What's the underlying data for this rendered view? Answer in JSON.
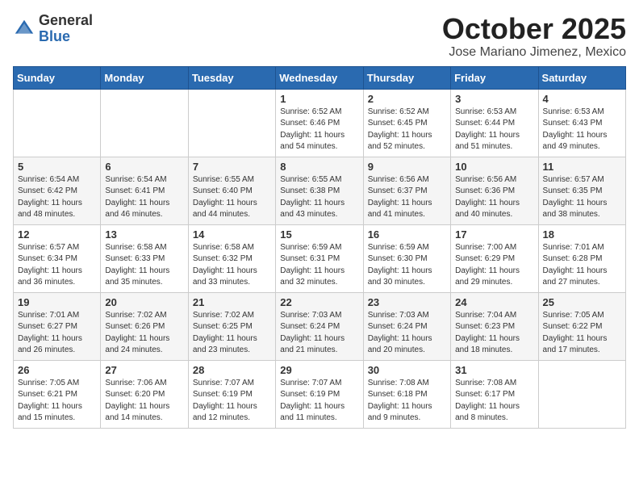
{
  "header": {
    "logo_general": "General",
    "logo_blue": "Blue",
    "month_title": "October 2025",
    "subtitle": "Jose Mariano Jimenez, Mexico"
  },
  "days_of_week": [
    "Sunday",
    "Monday",
    "Tuesday",
    "Wednesday",
    "Thursday",
    "Friday",
    "Saturday"
  ],
  "weeks": [
    [
      {
        "day": "",
        "info": ""
      },
      {
        "day": "",
        "info": ""
      },
      {
        "day": "",
        "info": ""
      },
      {
        "day": "1",
        "info": "Sunrise: 6:52 AM\nSunset: 6:46 PM\nDaylight: 11 hours\nand 54 minutes."
      },
      {
        "day": "2",
        "info": "Sunrise: 6:52 AM\nSunset: 6:45 PM\nDaylight: 11 hours\nand 52 minutes."
      },
      {
        "day": "3",
        "info": "Sunrise: 6:53 AM\nSunset: 6:44 PM\nDaylight: 11 hours\nand 51 minutes."
      },
      {
        "day": "4",
        "info": "Sunrise: 6:53 AM\nSunset: 6:43 PM\nDaylight: 11 hours\nand 49 minutes."
      }
    ],
    [
      {
        "day": "5",
        "info": "Sunrise: 6:54 AM\nSunset: 6:42 PM\nDaylight: 11 hours\nand 48 minutes."
      },
      {
        "day": "6",
        "info": "Sunrise: 6:54 AM\nSunset: 6:41 PM\nDaylight: 11 hours\nand 46 minutes."
      },
      {
        "day": "7",
        "info": "Sunrise: 6:55 AM\nSunset: 6:40 PM\nDaylight: 11 hours\nand 44 minutes."
      },
      {
        "day": "8",
        "info": "Sunrise: 6:55 AM\nSunset: 6:38 PM\nDaylight: 11 hours\nand 43 minutes."
      },
      {
        "day": "9",
        "info": "Sunrise: 6:56 AM\nSunset: 6:37 PM\nDaylight: 11 hours\nand 41 minutes."
      },
      {
        "day": "10",
        "info": "Sunrise: 6:56 AM\nSunset: 6:36 PM\nDaylight: 11 hours\nand 40 minutes."
      },
      {
        "day": "11",
        "info": "Sunrise: 6:57 AM\nSunset: 6:35 PM\nDaylight: 11 hours\nand 38 minutes."
      }
    ],
    [
      {
        "day": "12",
        "info": "Sunrise: 6:57 AM\nSunset: 6:34 PM\nDaylight: 11 hours\nand 36 minutes."
      },
      {
        "day": "13",
        "info": "Sunrise: 6:58 AM\nSunset: 6:33 PM\nDaylight: 11 hours\nand 35 minutes."
      },
      {
        "day": "14",
        "info": "Sunrise: 6:58 AM\nSunset: 6:32 PM\nDaylight: 11 hours\nand 33 minutes."
      },
      {
        "day": "15",
        "info": "Sunrise: 6:59 AM\nSunset: 6:31 PM\nDaylight: 11 hours\nand 32 minutes."
      },
      {
        "day": "16",
        "info": "Sunrise: 6:59 AM\nSunset: 6:30 PM\nDaylight: 11 hours\nand 30 minutes."
      },
      {
        "day": "17",
        "info": "Sunrise: 7:00 AM\nSunset: 6:29 PM\nDaylight: 11 hours\nand 29 minutes."
      },
      {
        "day": "18",
        "info": "Sunrise: 7:01 AM\nSunset: 6:28 PM\nDaylight: 11 hours\nand 27 minutes."
      }
    ],
    [
      {
        "day": "19",
        "info": "Sunrise: 7:01 AM\nSunset: 6:27 PM\nDaylight: 11 hours\nand 26 minutes."
      },
      {
        "day": "20",
        "info": "Sunrise: 7:02 AM\nSunset: 6:26 PM\nDaylight: 11 hours\nand 24 minutes."
      },
      {
        "day": "21",
        "info": "Sunrise: 7:02 AM\nSunset: 6:25 PM\nDaylight: 11 hours\nand 23 minutes."
      },
      {
        "day": "22",
        "info": "Sunrise: 7:03 AM\nSunset: 6:24 PM\nDaylight: 11 hours\nand 21 minutes."
      },
      {
        "day": "23",
        "info": "Sunrise: 7:03 AM\nSunset: 6:24 PM\nDaylight: 11 hours\nand 20 minutes."
      },
      {
        "day": "24",
        "info": "Sunrise: 7:04 AM\nSunset: 6:23 PM\nDaylight: 11 hours\nand 18 minutes."
      },
      {
        "day": "25",
        "info": "Sunrise: 7:05 AM\nSunset: 6:22 PM\nDaylight: 11 hours\nand 17 minutes."
      }
    ],
    [
      {
        "day": "26",
        "info": "Sunrise: 7:05 AM\nSunset: 6:21 PM\nDaylight: 11 hours\nand 15 minutes."
      },
      {
        "day": "27",
        "info": "Sunrise: 7:06 AM\nSunset: 6:20 PM\nDaylight: 11 hours\nand 14 minutes."
      },
      {
        "day": "28",
        "info": "Sunrise: 7:07 AM\nSunset: 6:19 PM\nDaylight: 11 hours\nand 12 minutes."
      },
      {
        "day": "29",
        "info": "Sunrise: 7:07 AM\nSunset: 6:19 PM\nDaylight: 11 hours\nand 11 minutes."
      },
      {
        "day": "30",
        "info": "Sunrise: 7:08 AM\nSunset: 6:18 PM\nDaylight: 11 hours\nand 9 minutes."
      },
      {
        "day": "31",
        "info": "Sunrise: 7:08 AM\nSunset: 6:17 PM\nDaylight: 11 hours\nand 8 minutes."
      },
      {
        "day": "",
        "info": ""
      }
    ]
  ]
}
